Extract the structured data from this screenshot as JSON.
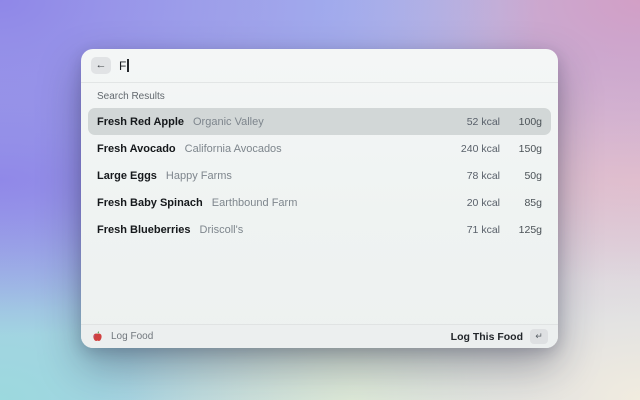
{
  "window": {
    "search": {
      "value": "F",
      "back_icon": "←"
    },
    "section_label": "Search Results",
    "results": [
      {
        "name": "Fresh Red Apple",
        "brand": "Organic Valley",
        "kcal": "52 kcal",
        "grams": "100g",
        "selected": true
      },
      {
        "name": "Fresh Avocado",
        "brand": "California Avocados",
        "kcal": "240 kcal",
        "grams": "150g",
        "selected": false
      },
      {
        "name": "Large Eggs",
        "brand": "Happy Farms",
        "kcal": "78 kcal",
        "grams": "50g",
        "selected": false
      },
      {
        "name": "Fresh Baby Spinach",
        "brand": "Earthbound Farm",
        "kcal": "20 kcal",
        "grams": "85g",
        "selected": false
      },
      {
        "name": "Fresh Blueberries",
        "brand": "Driscoll's",
        "kcal": "71 kcal",
        "grams": "125g",
        "selected": false
      }
    ],
    "footer": {
      "app_label": "Log Food",
      "action_label": "Log This Food",
      "action_key_icon": "↵"
    }
  },
  "colors": {
    "selected_row": "#d2d7d7",
    "window_bg": "#f1f4f3",
    "backdrop_top_left": "#8f87e8",
    "backdrop_top_right": "#d29fc6",
    "backdrop_bottom_left": "#9cd9de",
    "backdrop_bottom_right": "#f1ecdf"
  }
}
